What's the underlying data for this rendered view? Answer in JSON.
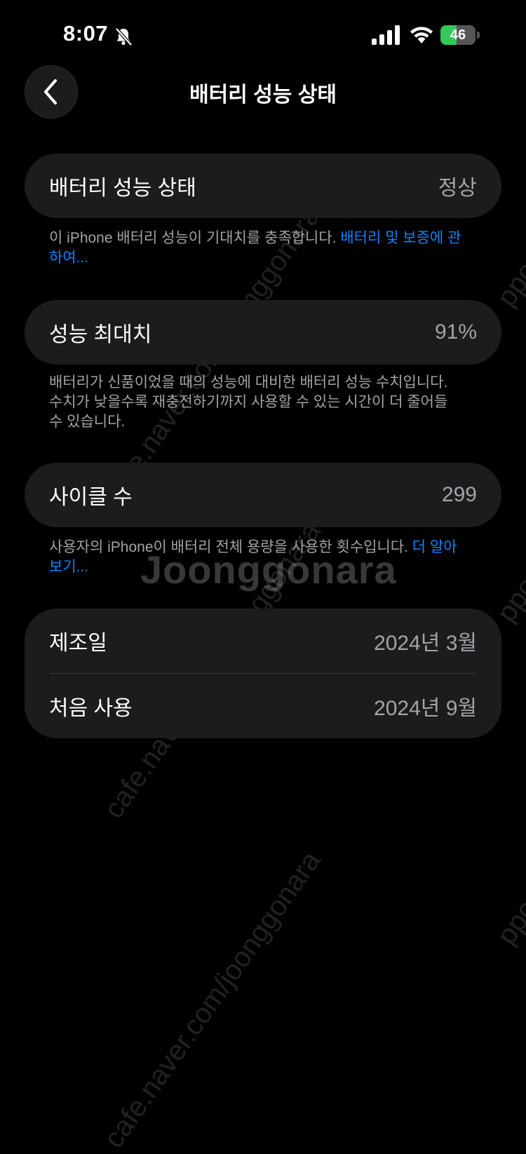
{
  "status_bar": {
    "time": "8:07",
    "battery_level": "46",
    "battery_fraction": 0.46,
    "icons": [
      "bell-slash-icon",
      "cellular-signal-icon",
      "wifi-icon",
      "battery-charging-icon"
    ]
  },
  "nav": {
    "back_icon": "chevron-left-icon",
    "title": "배터리 성능 상태"
  },
  "battery_health": {
    "label": "배터리 성능 상태",
    "value": "정상",
    "note": "이 iPhone 배터리 성능이 기대치를 충족합니다. ",
    "link": "배터리 및 보증에 관하여..."
  },
  "max_capacity": {
    "label": "성능 최대치",
    "value": "91%",
    "note": "배터리가 신품이었을 때의 성능에 대비한 배터리 성능 수치입니다. 수치가 낮을수록 재충전하기까지 사용할 수 있는 시간이 더 줄어들 수 있습니다."
  },
  "cycle_count": {
    "label": "사이클 수",
    "value": "299",
    "note": "사용자의 iPhone이 배터리 전체 용량을 사용한 횟수입니다. ",
    "link": "더 알아보기..."
  },
  "dates": {
    "manufacture_label": "제조일",
    "manufacture_value": "2024년 3월",
    "first_use_label": "처음 사용",
    "first_use_value": "2024년 9월"
  },
  "watermark": {
    "logo": "Joonggonara",
    "url": "cafe.naver.com/joonggonara",
    "side": "ppo"
  },
  "colors": {
    "background": "#000000",
    "card": "#1c1c1e",
    "secondary_text": "#a3a3a8",
    "link": "#0a84ff",
    "battery_green": "#34c759"
  }
}
